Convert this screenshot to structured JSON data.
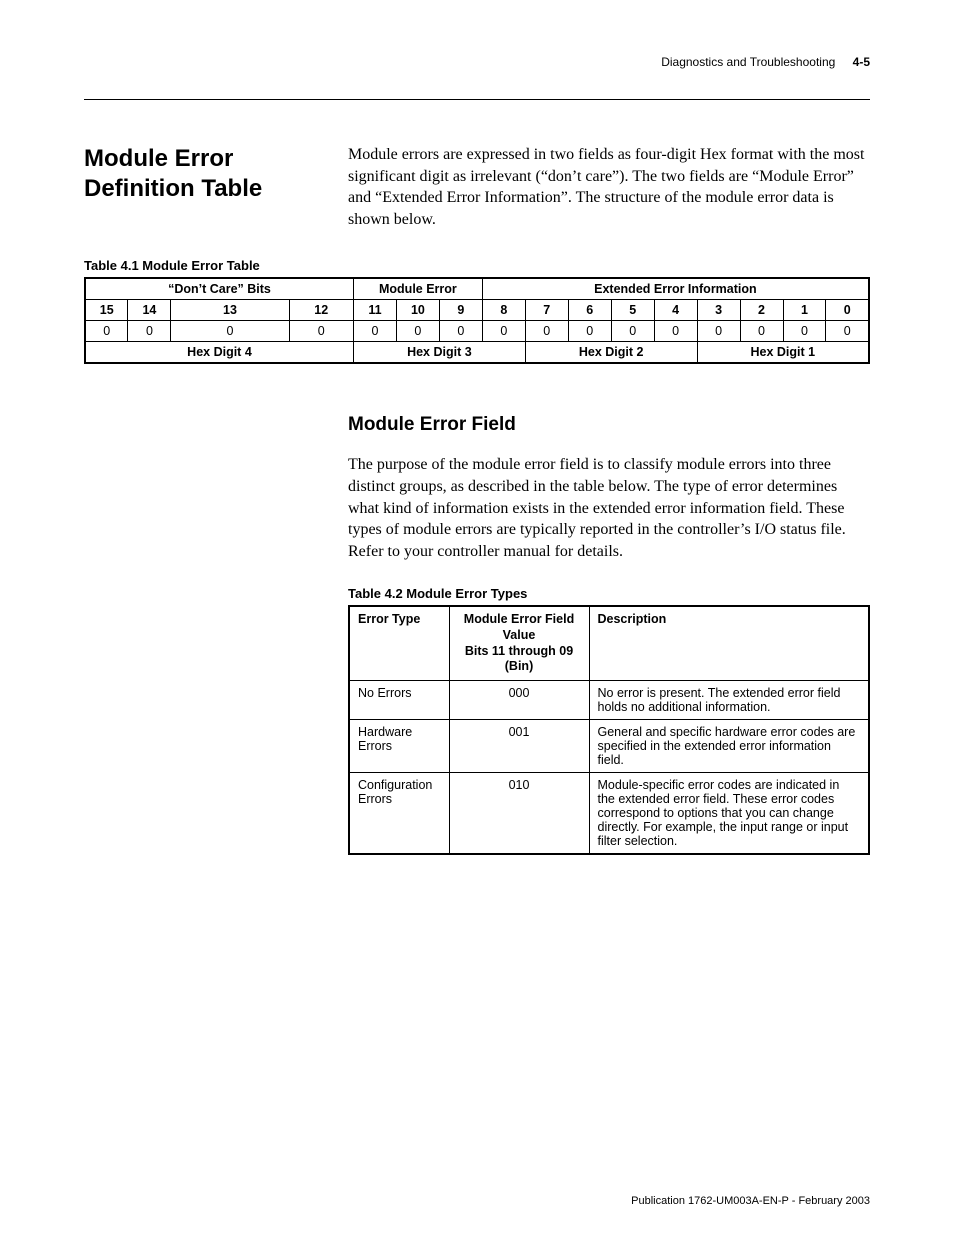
{
  "header": {
    "running_title": "Diagnostics and Troubleshooting",
    "page_number": "4-5"
  },
  "section1": {
    "title": "Module Error Definition Table",
    "intro": "Module errors are expressed in two fields as four-digit Hex format with the most significant digit as irrelevant (“don’t care”). The two fields are “Module Error” and “Extended Error Information”. The structure of the module error data is shown below."
  },
  "table41": {
    "caption": "Table 4.1 Module Error Table",
    "group_headers": {
      "dont_care": "“Don’t Care” Bits",
      "module_error": "Module Error",
      "extended": "Extended Error Information"
    },
    "bit_numbers": [
      "15",
      "14",
      "13",
      "12",
      "11",
      "10",
      "9",
      "8",
      "7",
      "6",
      "5",
      "4",
      "3",
      "2",
      "1",
      "0"
    ],
    "bit_values": [
      "0",
      "0",
      "0",
      "0",
      "0",
      "0",
      "0",
      "0",
      "0",
      "0",
      "0",
      "0",
      "0",
      "0",
      "0",
      "0"
    ],
    "hex_labels": [
      "Hex Digit 4",
      "Hex Digit 3",
      "Hex Digit 2",
      "Hex Digit 1"
    ]
  },
  "section2": {
    "title": "Module Error Field",
    "para": "The purpose of the module error field is to classify module errors into three distinct groups, as described in the table below. The type of error determines what kind of information exists in the extended error information field. These types of module errors are typically reported in the controller’s I/O status file. Refer to your controller manual for details."
  },
  "table42": {
    "caption": "Table 4.2 Module Error Types",
    "headers": {
      "type": "Error Type",
      "value_l1": "Module Error Field Value",
      "value_l2": "Bits 11 through 09 (Bin)",
      "desc": "Description"
    },
    "rows": [
      {
        "type": "No Errors",
        "value": "000",
        "desc": "No error is present. The extended error field holds no additional information."
      },
      {
        "type": "Hardware Errors",
        "value": "001",
        "desc": "General and specific hardware error codes are specified in the extended error information field."
      },
      {
        "type": "Configuration Errors",
        "value": "010",
        "desc": "Module-specific error codes are indicated in the extended error field. These error codes correspond to options that you can change directly. For example, the input range or input filter selection."
      }
    ]
  },
  "footer": {
    "publication": "Publication 1762-UM003A-EN-P - February 2003"
  }
}
